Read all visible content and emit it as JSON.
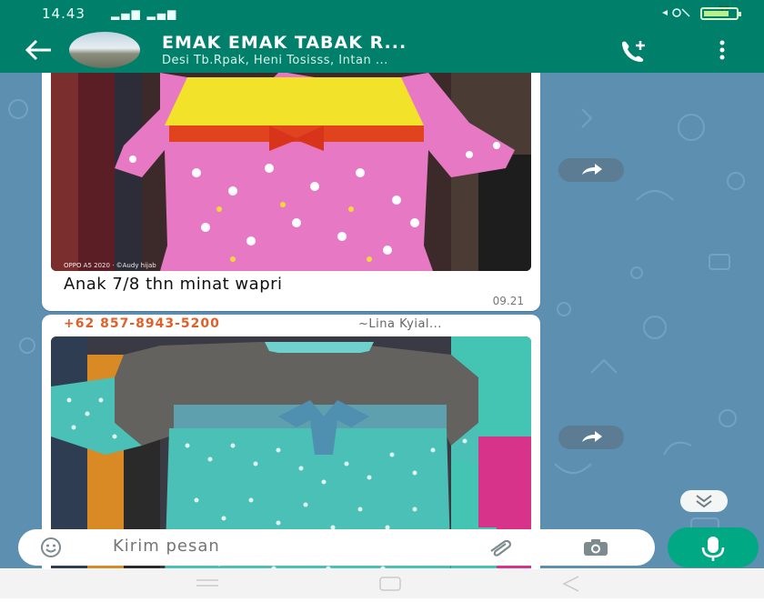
{
  "status_bar": {
    "time": "14.43",
    "battery": "57"
  },
  "header": {
    "title": "EMAK EMAK TABAK R...",
    "subtitle": "Desi Tb.Rpak, Heni Tosisss, Intan ..."
  },
  "messages": [
    {
      "caption": "Anak 7/8 thn minat wapri",
      "time": "09.21",
      "watermark": "OPPO A5 2020 · ©Audy hijab"
    },
    {
      "sender": "+62 857-8943-5200",
      "push_name": "~Lina Kyial..."
    }
  ],
  "composer": {
    "placeholder": "Kirim pesan"
  },
  "icons": {
    "back": "arrow-left-icon",
    "call": "add-call-icon",
    "more": "more-vert-icon",
    "forward": "forward-icon",
    "scroll": "chevron-double-down-icon",
    "emoji": "emoji-icon",
    "attach": "paperclip-icon",
    "camera": "camera-icon",
    "mic": "mic-icon"
  },
  "colors": {
    "header": "#00806a",
    "chat_bg": "#5d8fb1",
    "sender": "#e0602a",
    "mic_button": "#00a884"
  }
}
